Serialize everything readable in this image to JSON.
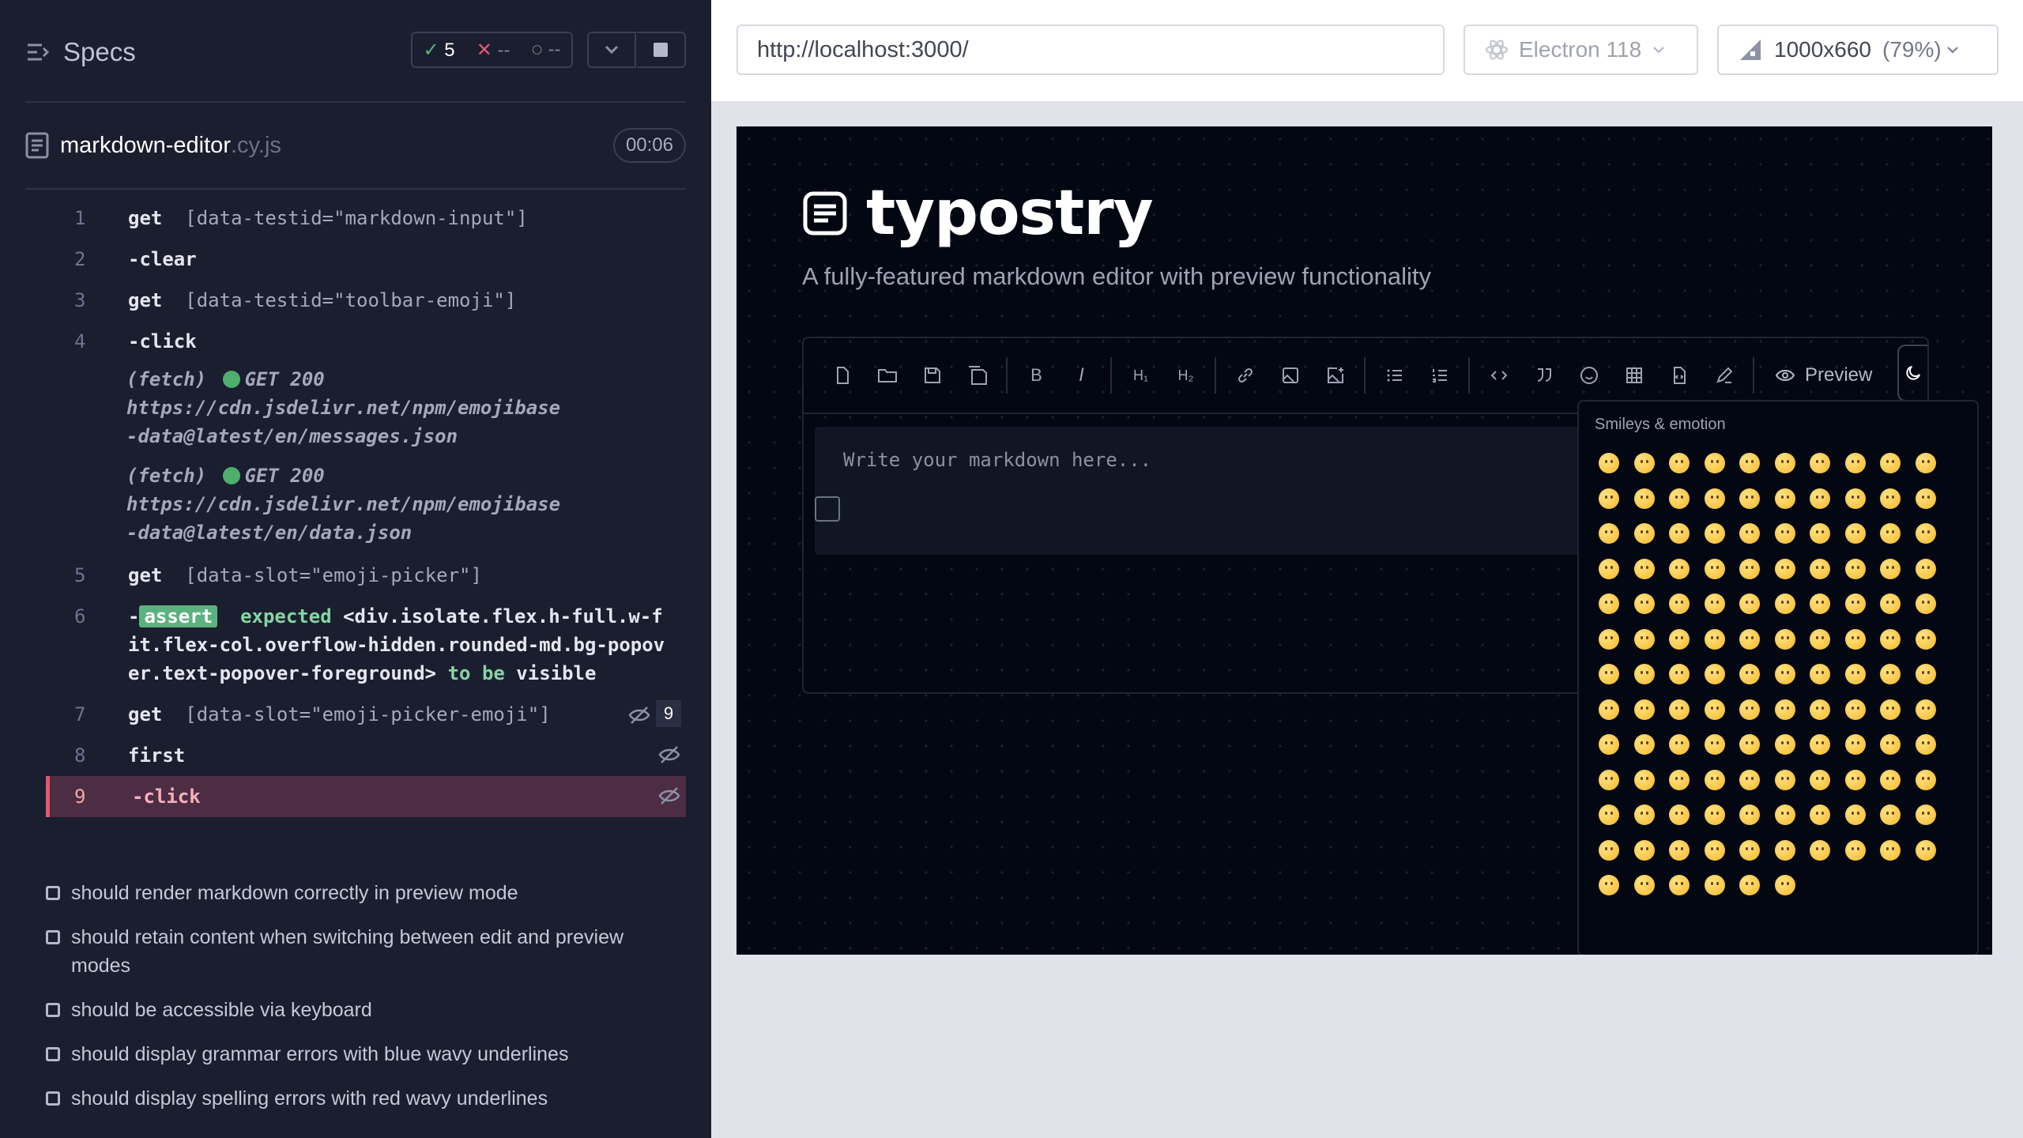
{
  "sidebar": {
    "title": "Specs",
    "stats": {
      "passed": "5",
      "failed": "--",
      "pending": "--"
    },
    "file": {
      "name": "markdown-editor",
      "ext": ".cy.js",
      "duration": "00:06"
    },
    "commands": [
      {
        "num": "1",
        "name": "get",
        "arg": "[data-testid=\"markdown-input\"]"
      },
      {
        "num": "2",
        "name": "-clear",
        "arg": ""
      },
      {
        "num": "3",
        "name": "get",
        "arg": "[data-testid=\"toolbar-emoji\"]"
      },
      {
        "num": "4",
        "name": "-click",
        "arg": ""
      },
      {
        "num": "5",
        "name": "get",
        "arg": "[data-slot=\"emoji-picker\"]"
      },
      {
        "num": "6",
        "name": "-",
        "arg": ""
      },
      {
        "num": "7",
        "name": "get",
        "arg": "[data-slot=\"emoji-picker-emoji\"]",
        "count": "9"
      },
      {
        "num": "8",
        "name": "first",
        "arg": ""
      },
      {
        "num": "9",
        "name": "-click",
        "arg": ""
      }
    ],
    "fetch1": {
      "label": "(fetch)",
      "status": "GET 200",
      "url": "https://cdn.jsdelivr.net/npm/emojibase-data@latest/en/messages.json"
    },
    "fetch2": {
      "label": "(fetch)",
      "status": "GET 200",
      "url": "https://cdn.jsdelivr.net/npm/emojibase-data@latest/en/data.json"
    },
    "assertion": {
      "badge": "assert",
      "expected": "expected",
      "selector": "<div.isolate.flex.h-full.w-fit.flex-col.overflow-hidden.rounded-md.bg-popover.text-popover-foreground>",
      "tobe": "to be",
      "state": "visible"
    },
    "tests": [
      "should render markdown correctly in preview mode",
      "should retain content when switching between edit and preview modes",
      "should be accessible via keyboard",
      "should display grammar errors with blue wavy underlines",
      "should display spelling errors with red wavy underlines"
    ]
  },
  "topbar": {
    "url": "http://localhost:3000/",
    "browser": "Electron 118",
    "viewport": "1000x660",
    "scale": "(79%)"
  },
  "app": {
    "logo": "typostry",
    "tagline": "A fully-featured markdown editor with preview functionality",
    "preview_label": "Preview",
    "placeholder": "Write your markdown here...",
    "picker_category": "Smileys & emotion"
  },
  "colors": {
    "sidebar_bg": "#1b1e2e",
    "active_row": "#4d2d43",
    "pass": "#5cb27e",
    "fail": "#e45770"
  }
}
